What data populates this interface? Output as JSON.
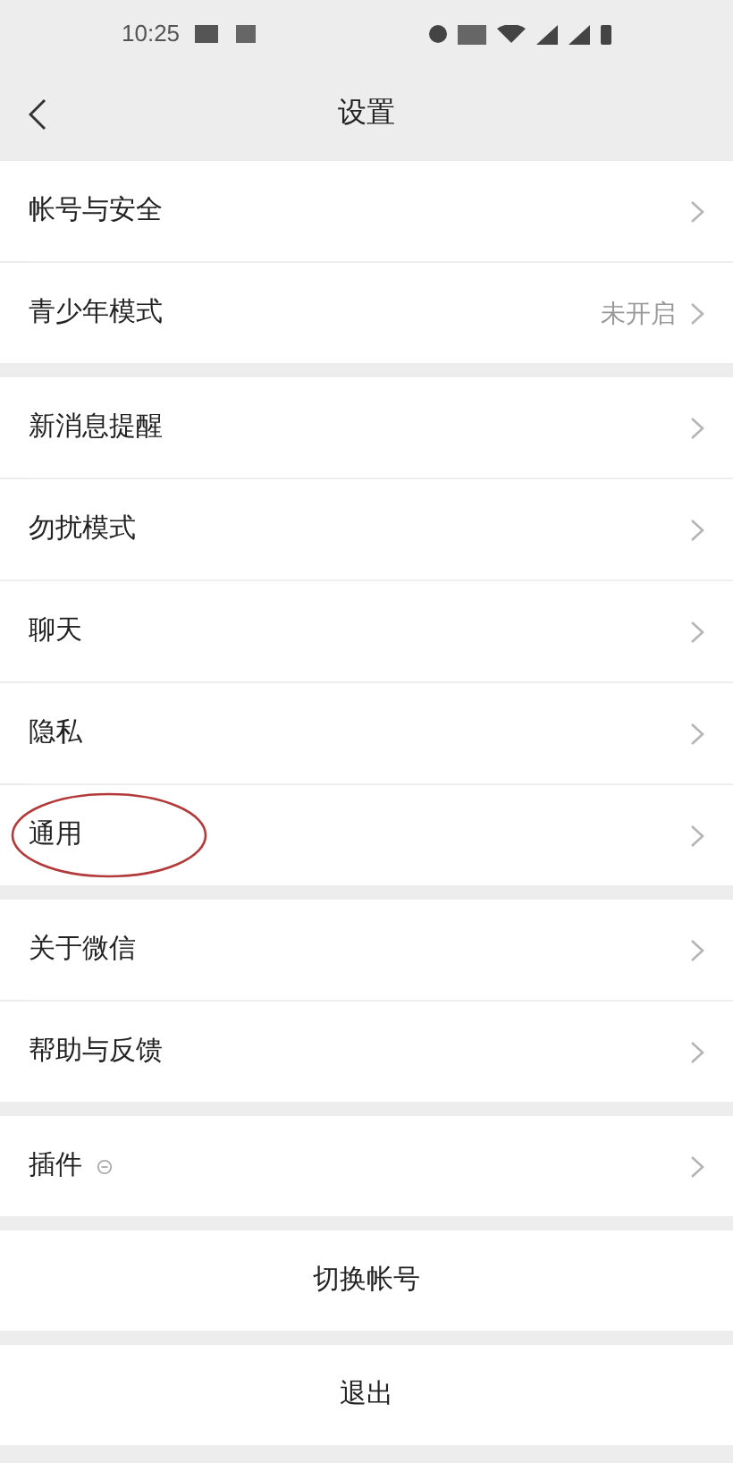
{
  "status_bar": {
    "time": "10:25"
  },
  "header": {
    "title": "设置"
  },
  "groups": [
    {
      "items": [
        {
          "label": "帐号与安全"
        },
        {
          "label": "青少年模式",
          "value": "未开启"
        }
      ]
    },
    {
      "items": [
        {
          "label": "新消息提醒"
        },
        {
          "label": "勿扰模式"
        },
        {
          "label": "聊天"
        },
        {
          "label": "隐私"
        },
        {
          "label": "通用",
          "circled": true
        }
      ]
    },
    {
      "items": [
        {
          "label": "关于微信"
        },
        {
          "label": "帮助与反馈"
        }
      ]
    },
    {
      "items": [
        {
          "label": "插件",
          "badge": true
        }
      ]
    }
  ],
  "actions": [
    "切换帐号",
    "退出"
  ]
}
